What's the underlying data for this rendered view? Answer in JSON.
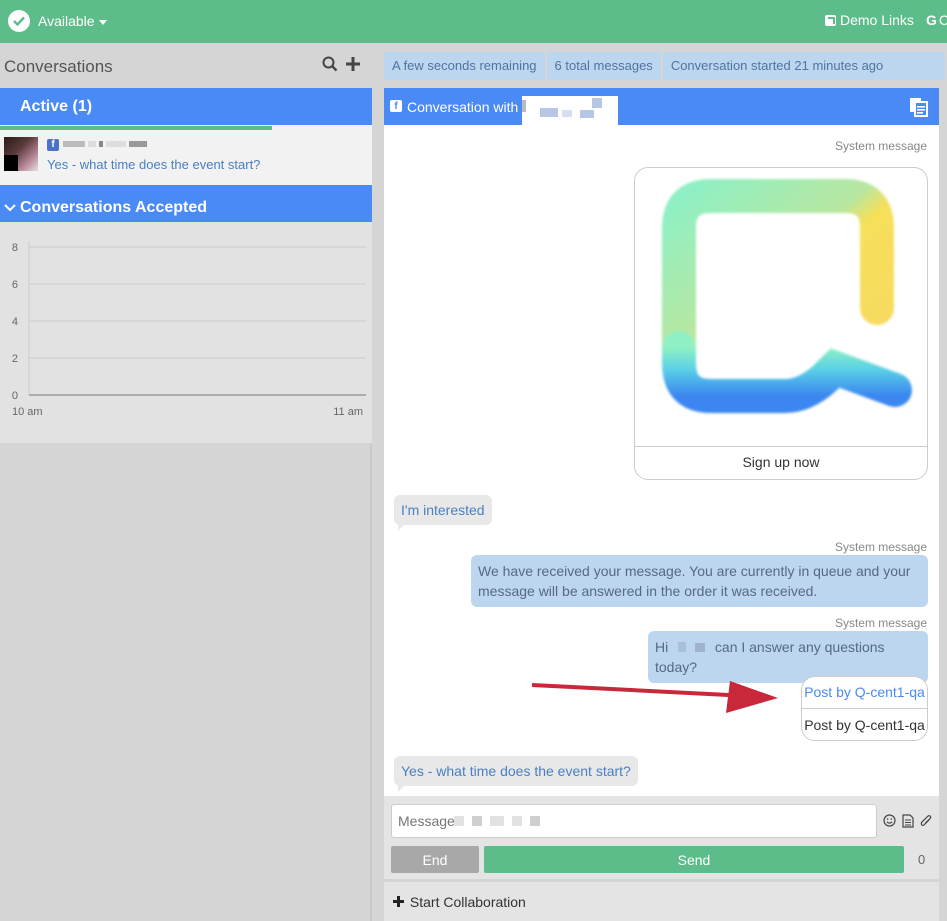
{
  "topbar": {
    "status_label": "Available",
    "demo_links_label": "Demo Links",
    "extra_link_label": "G"
  },
  "sidebar": {
    "conversations_title": "Conversations",
    "active_label": "Active",
    "active_count": "(1)",
    "conversation_preview": "Yes - what time does the event start?",
    "accepted_label": "Conversations Accepted",
    "accepted_progress_fraction": 0.73
  },
  "chart_data": {
    "type": "line",
    "x": [
      "10 am",
      "11 am"
    ],
    "series": [
      {
        "values": [
          0,
          0
        ]
      }
    ],
    "yticks": [
      0,
      2,
      4,
      6,
      8
    ],
    "ylim": [
      0,
      8
    ],
    "grid": true
  },
  "infobar": {
    "remaining": "A few seconds remaining",
    "total_messages": "6 total messages",
    "started": "Conversation started 21 minutes ago"
  },
  "conversation": {
    "header_prefix": "Conversation with",
    "system_label": "System message",
    "card_button": "Sign up now",
    "msg_interested": "I'm interested",
    "msg_received": "We have received your message. You are currently in queue and your message will be answered in the order it was received.",
    "msg_hi_prefix": "Hi",
    "msg_hi_suffix": "can I answer any questions today?",
    "quick_reply_top": "Post by Q-cent1-qa",
    "quick_reply_bottom": "Post by Q-cent1-qa",
    "msg_event": "Yes - what time does the event start?"
  },
  "composer": {
    "placeholder": "Message",
    "end_label": "End",
    "send_label": "Send",
    "char_count": "0"
  },
  "collaboration": {
    "label": "Start Collaboration"
  },
  "colors": {
    "topbar": "#5dbd8a",
    "section_blue": "#4a8af4",
    "bubble_out": "#bcd6ef",
    "arrow_red": "#c8283a"
  }
}
